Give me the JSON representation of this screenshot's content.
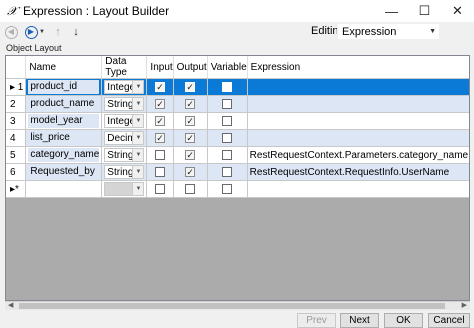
{
  "window": {
    "title": "Expression : Layout Builder",
    "app_icon_glyph": "𝒳",
    "minimize_glyph": "—",
    "maximize_glyph": "☐",
    "close_glyph": "✕"
  },
  "toolbar": {
    "back_icon": "back-circle-icon",
    "forward_icon": "forward-circle-icon",
    "up_icon": "up-arrow-icon",
    "down_icon": "down-arrow-icon",
    "editing_label": "Editing:",
    "editing_value": "Expression"
  },
  "object_layout": {
    "label": "Object Layout",
    "columns": [
      "Name",
      "Data Type",
      "Input",
      "Output",
      "Variable",
      "Expression"
    ],
    "rows": [
      {
        "marker": "▸ 1",
        "name": "product_id",
        "data_type": "Integer",
        "input": true,
        "output": true,
        "variable": false,
        "expression": "",
        "selected": true
      },
      {
        "marker": "2",
        "name": "product_name",
        "data_type": "String",
        "input": true,
        "output": true,
        "variable": false,
        "expression": ""
      },
      {
        "marker": "3",
        "name": "model_year",
        "data_type": "Integer",
        "input": true,
        "output": true,
        "variable": false,
        "expression": ""
      },
      {
        "marker": "4",
        "name": "list_price",
        "data_type": "Decimal",
        "input": true,
        "output": true,
        "variable": false,
        "expression": ""
      },
      {
        "marker": "5",
        "name": "category_name",
        "data_type": "String",
        "input": false,
        "output": true,
        "variable": false,
        "expression": "RestRequestContext.Parameters.category_name"
      },
      {
        "marker": "6",
        "name": "Requested_by",
        "data_type": "String",
        "input": false,
        "output": true,
        "variable": false,
        "expression": "RestRequestContext.RequestInfo.UserName"
      },
      {
        "marker": "▸*",
        "name": "",
        "data_type": "",
        "input": false,
        "output": false,
        "variable": false,
        "expression": "",
        "new_row": true
      }
    ]
  },
  "buttons": {
    "prev": "Prev",
    "next": "Next",
    "ok": "OK",
    "cancel": "Cancel"
  },
  "colors": {
    "selection": "#0b79d6",
    "alt_row": "#dce6f4"
  }
}
